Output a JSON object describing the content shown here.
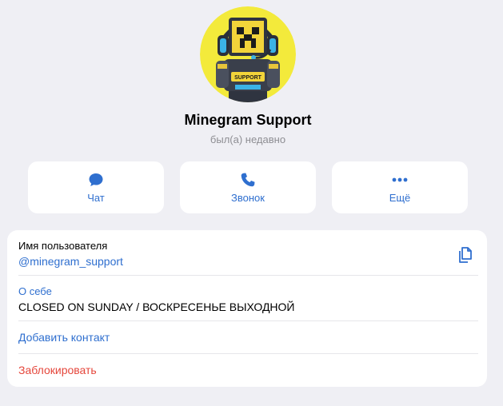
{
  "profile": {
    "name": "Minegram Support",
    "status": "был(а) недавно",
    "avatar_badge": "SUPPORT"
  },
  "actions": [
    {
      "label": "Чат",
      "icon": "chat-bubble-icon"
    },
    {
      "label": "Звонок",
      "icon": "phone-icon"
    },
    {
      "label": "Ещё",
      "icon": "more-dots-icon"
    }
  ],
  "info": {
    "username_label": "Имя пользователя",
    "username_value": "@minegram_support",
    "about_label": "О себе",
    "about_value": "CLOSED ON SUNDAY / ВОСКРЕСЕНЬЕ ВЫХОДНОЙ",
    "add_contact": "Добавить контакт",
    "block": "Заблокировать"
  },
  "colors": {
    "accent": "#2f6fcf",
    "danger": "#e5473c",
    "background": "#efeff4",
    "avatar_bg": "#f3ea3b"
  }
}
